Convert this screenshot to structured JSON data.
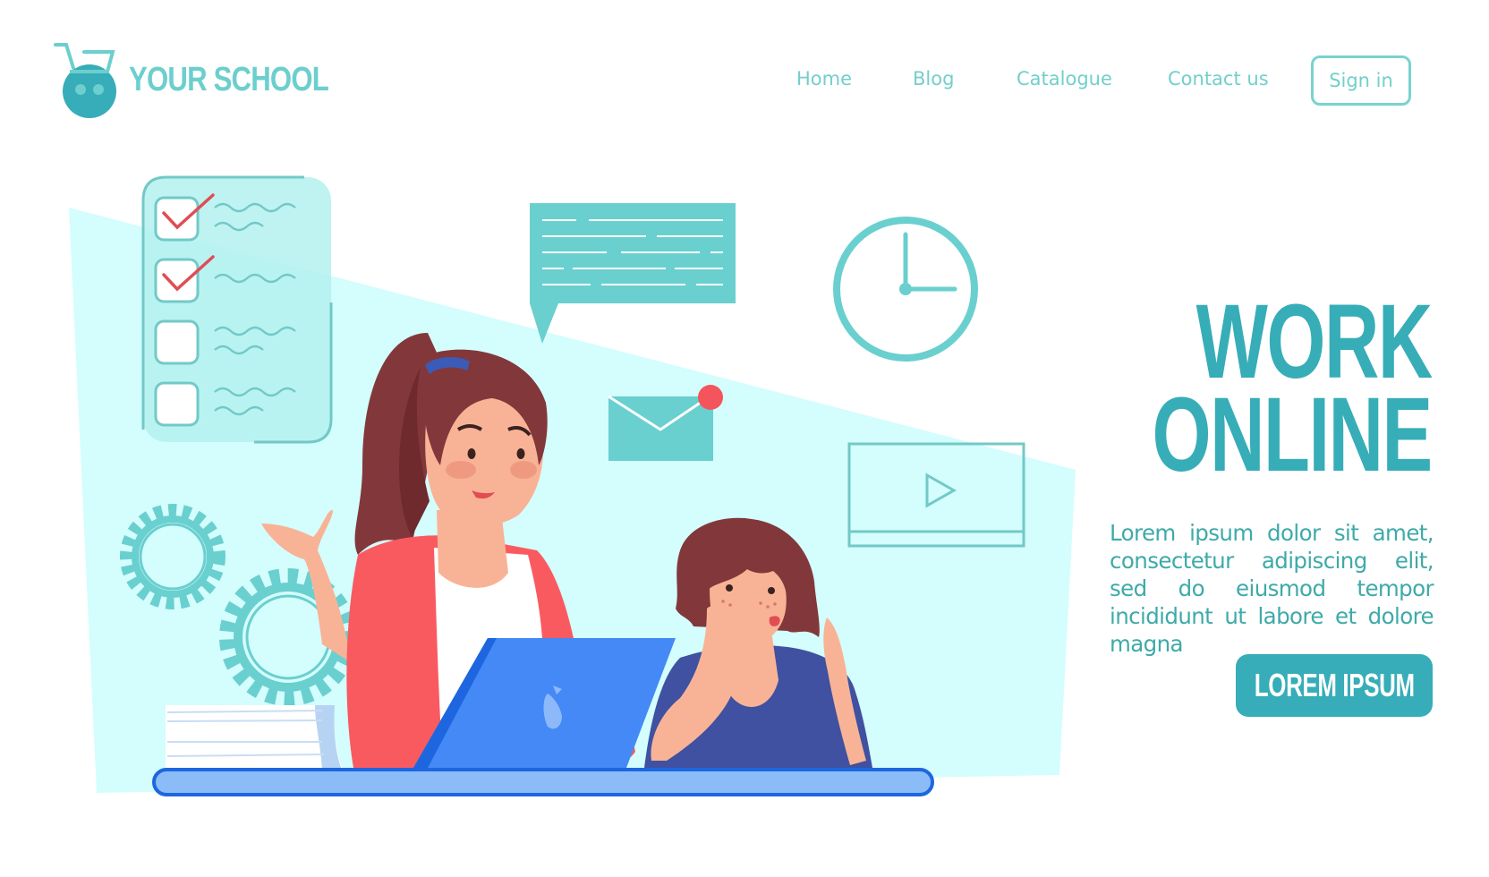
{
  "brand": {
    "name": "YOUR SCHOOL",
    "logo_icon": "shopping-cart-robot-icon",
    "color": "#6ccfcd"
  },
  "nav": {
    "links": [
      {
        "label": "Home"
      },
      {
        "label": "Blog"
      },
      {
        "label": "Catalogue"
      },
      {
        "label": "Contact us"
      }
    ],
    "signin_label": "Sign in"
  },
  "hero": {
    "title_lines": [
      "WORK",
      "ONLINE"
    ],
    "paragraph": "Lorem ipsum dolor sit amet, consectetur adipiscing elit, sed do eiusmod tempor incididunt ut labore et dolore magna",
    "cta_label": "LOREM IPSUM"
  },
  "illustration": {
    "description": "Mother working on laptop with bored daughter at desk",
    "icons": [
      "checklist-icon",
      "speech-bubble-icon",
      "envelope-icon",
      "notification-dot-icon",
      "clock-icon",
      "video-player-icon",
      "gear-icon",
      "books-icon",
      "laptop-icon"
    ],
    "checklist": {
      "items": [
        {
          "checked": true
        },
        {
          "checked": true
        },
        {
          "checked": false
        },
        {
          "checked": false
        }
      ]
    },
    "clock_time": "3:00"
  },
  "colors": {
    "accent": "#36adb8",
    "nav": "#72cfcb",
    "illustration_teal": "#6acfcf",
    "background_shape": "#d4fdfd",
    "alert": "#f4545c",
    "laptop": "#4489f5",
    "desk": "#8bbcf7"
  }
}
